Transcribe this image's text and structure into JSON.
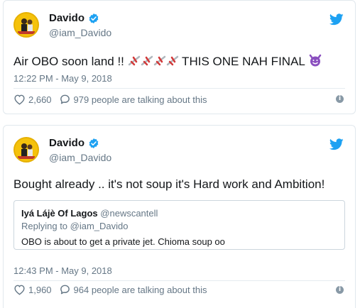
{
  "tweets": [
    {
      "name": "Davido",
      "handle": "@iam_Davido",
      "text_before": "Air OBO soon land !! ",
      "text_after": " THIS ONE NAH FINAL ",
      "airplane_emoji_count": 4,
      "time": "12:22 PM - May 9, 2018",
      "likes": "2,660",
      "talking": "979 people are talking about this"
    },
    {
      "name": "Davido",
      "handle": "@iam_Davido",
      "text": "Bought already .. it's not soup it's Hard work and Ambition!",
      "quote": {
        "name": "Iyá Lájè Of Lagos",
        "handle": "@newscantell",
        "replying": "Replying to @iam_Davido",
        "text": "OBO is about to get a private jet. Chioma soup oo"
      },
      "time": "12:43 PM - May 9, 2018",
      "likes": "1,960",
      "talking": "964 people are talking about this"
    }
  ],
  "colors": {
    "verified": "#1da1f2",
    "twitter_bird": "#1da1f2",
    "muted": "#657786",
    "border": "#e1e8ed"
  },
  "icons": [
    "verified-badge-icon",
    "twitter-bird-icon",
    "heart-icon",
    "comment-bubble-icon",
    "info-icon",
    "airplane-emoji",
    "smiling-devil-emoji"
  ]
}
